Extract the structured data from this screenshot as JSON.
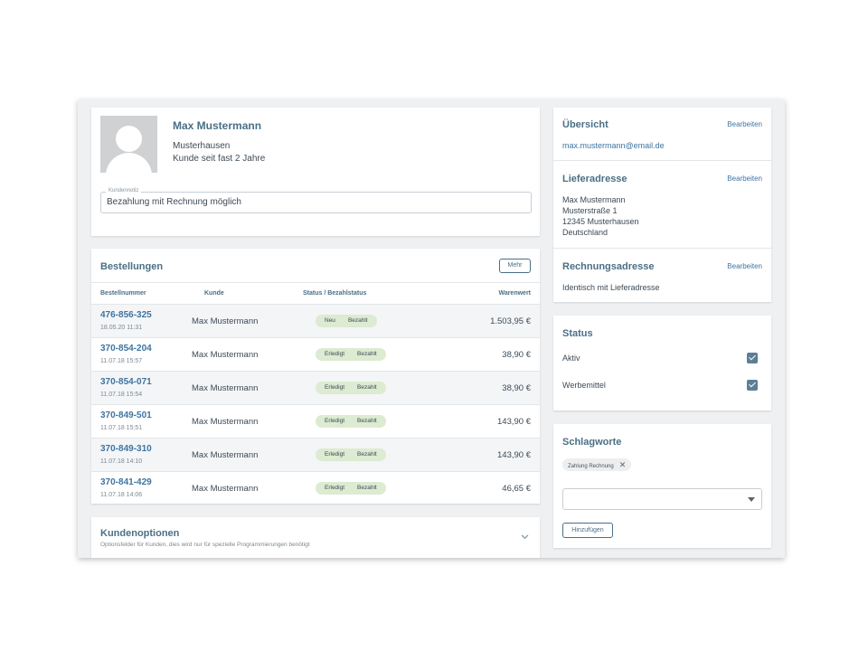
{
  "customer": {
    "name": "Max Mustermann",
    "city": "Musterhausen",
    "since": "Kunde seit fast 2 Jahre",
    "note_label": "Kundennotiz",
    "note_value": "Bezahlung mit Rechnung möglich"
  },
  "orders": {
    "title": "Bestellungen",
    "more_label": "Mehr",
    "columns": [
      "Bestellnummer",
      "Kunde",
      "Status / Bezahlstatus",
      "Warenwert"
    ],
    "rows": [
      {
        "number": "476-856-325",
        "date": "18.05.20 11:31",
        "customer": "Max Mustermann",
        "status": "Neu",
        "payment": "Bezahlt",
        "amount": "1.503,95 €"
      },
      {
        "number": "370-854-204",
        "date": "11.07.18 15:57",
        "customer": "Max Mustermann",
        "status": "Erledigt",
        "payment": "Bezahlt",
        "amount": "38,90 €"
      },
      {
        "number": "370-854-071",
        "date": "11.07.18 15:54",
        "customer": "Max Mustermann",
        "status": "Erledigt",
        "payment": "Bezahlt",
        "amount": "38,90 €"
      },
      {
        "number": "370-849-501",
        "date": "11.07.18 15:51",
        "customer": "Max Mustermann",
        "status": "Erledigt",
        "payment": "Bezahlt",
        "amount": "143,90 €"
      },
      {
        "number": "370-849-310",
        "date": "11.07.18 14:10",
        "customer": "Max Mustermann",
        "status": "Erledigt",
        "payment": "Bezahlt",
        "amount": "143,90 €"
      },
      {
        "number": "370-841-429",
        "date": "11.07.18 14:06",
        "customer": "Max Mustermann",
        "status": "Erledigt",
        "payment": "Bezahlt",
        "amount": "46,65 €"
      }
    ]
  },
  "options": {
    "title": "Kundenoptionen",
    "description": "Optionsfelder für Kunden, dies wird nur für spezielle Programmierungen benötigt"
  },
  "overview": {
    "title": "Übersicht",
    "edit_label": "Bearbeiten",
    "email": "max.mustermann@email.de",
    "shipping_title": "Lieferadresse",
    "shipping_lines": [
      "Max Mustermann",
      "Musterstraße 1",
      "12345 Musterhausen",
      "Deutschland"
    ],
    "billing_title": "Rechnungsadresse",
    "billing_text": "Identisch mit Lieferadresse"
  },
  "status": {
    "title": "Status",
    "active_label": "Aktiv",
    "active_checked": true,
    "ads_label": "Werbemittel",
    "ads_checked": true
  },
  "tags": {
    "title": "Schlagworte",
    "items": [
      "Zahlung Rechnung"
    ],
    "select_value": "",
    "add_label": "Hinzufügen"
  },
  "colors": {
    "accent": "#4a6f86",
    "link": "#3f74a0",
    "status_badge": "#dcebd1",
    "background": "#eef0f2"
  }
}
